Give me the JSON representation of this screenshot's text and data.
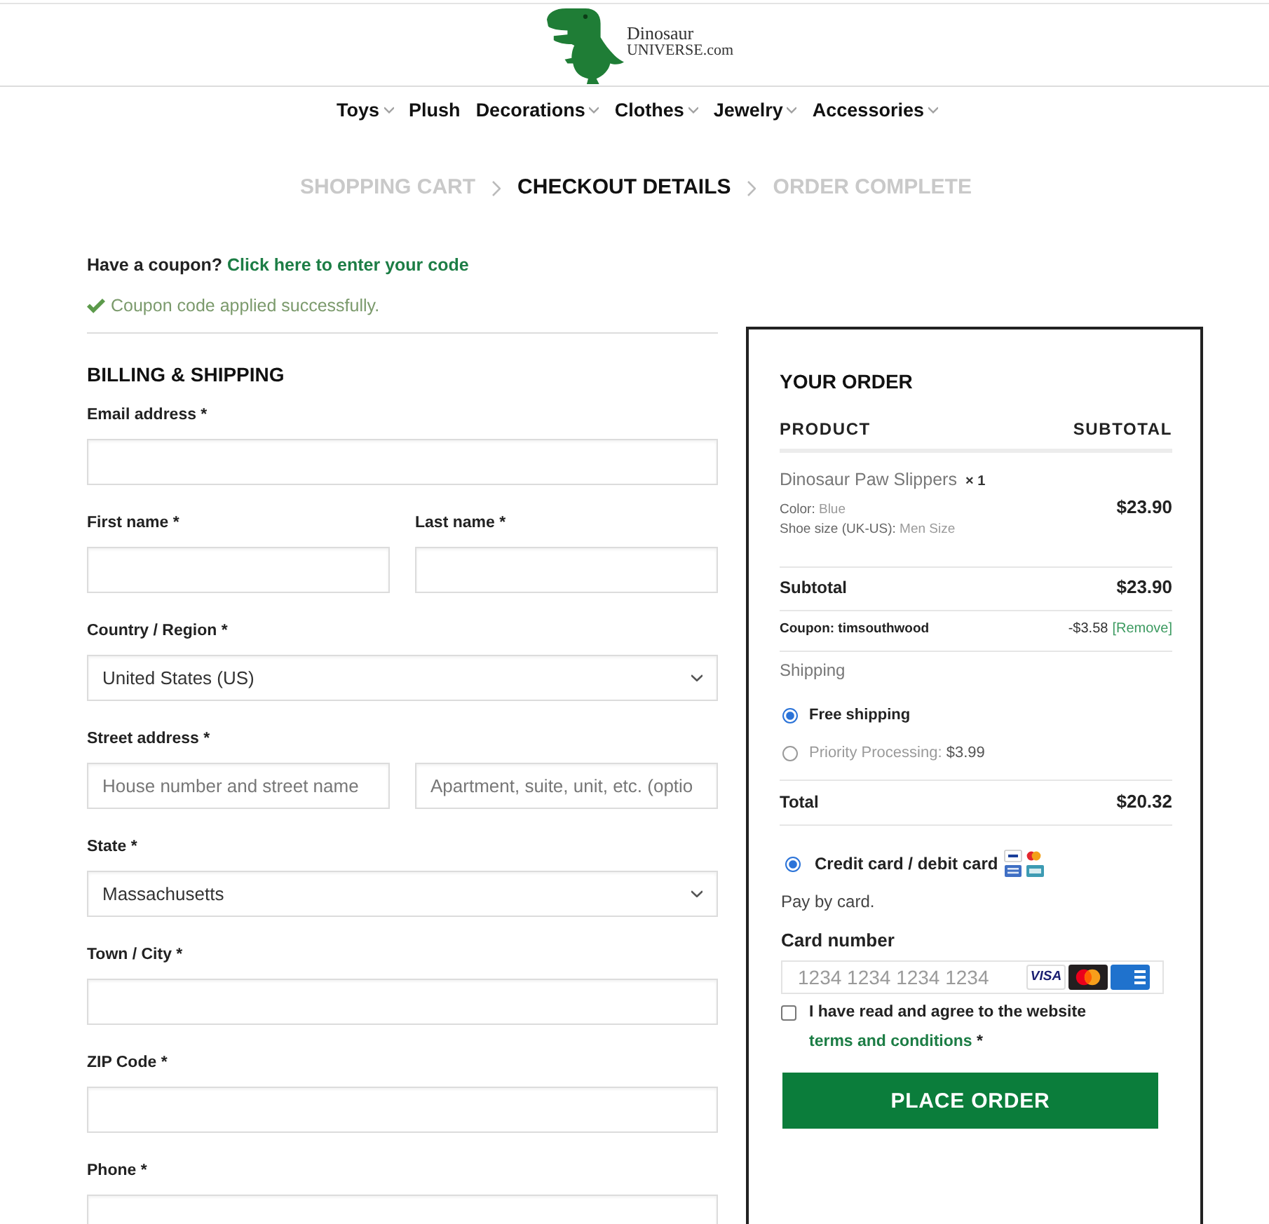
{
  "header": {
    "logo": {
      "name": "Dinosaur",
      "domain": "UNIVERSE.com"
    },
    "nav": [
      {
        "label": "Toys",
        "dropdown": true
      },
      {
        "label": "Plush",
        "dropdown": false
      },
      {
        "label": "Decorations",
        "dropdown": true
      },
      {
        "label": "Clothes",
        "dropdown": true
      },
      {
        "label": "Jewelry",
        "dropdown": true
      },
      {
        "label": "Accessories",
        "dropdown": true
      }
    ]
  },
  "steps": [
    {
      "label": "SHOPPING CART",
      "selected": false
    },
    {
      "label": "CHECKOUT DETAILS",
      "selected": true
    },
    {
      "label": "ORDER COMPLETE",
      "selected": false
    }
  ],
  "coupon": {
    "prompt": "Have a coupon?",
    "link": "Click here to enter your code",
    "notice": "Coupon code applied successfully."
  },
  "billing": {
    "title": "BILLING & SHIPPING",
    "rows": [
      {
        "fields": [
          {
            "label": "Email address *",
            "inputs": [
              {
                "kind": "text"
              }
            ]
          }
        ]
      },
      {
        "fields": [
          {
            "label": "First name *",
            "inputs": [
              {
                "kind": "text"
              }
            ]
          },
          {
            "label": "Last name *",
            "inputs": [
              {
                "kind": "text"
              }
            ]
          }
        ]
      },
      {
        "fields": [
          {
            "label": "Country / Region *",
            "inputs": [
              {
                "kind": "select",
                "value": "United States (US)"
              }
            ]
          }
        ]
      },
      {
        "fields": [
          {
            "label": "Street address *",
            "inputs": [
              {
                "kind": "text",
                "placeholder": "House number and street name"
              },
              {
                "kind": "text",
                "placeholder": "Apartment, suite, unit, etc. (optio"
              }
            ]
          }
        ]
      },
      {
        "fields": [
          {
            "label": "State *",
            "inputs": [
              {
                "kind": "select",
                "value": "Massachusetts"
              }
            ]
          }
        ]
      },
      {
        "fields": [
          {
            "label": "Town / City *",
            "inputs": [
              {
                "kind": "text"
              }
            ]
          }
        ]
      },
      {
        "fields": [
          {
            "label": "ZIP Code *",
            "inputs": [
              {
                "kind": "text"
              }
            ]
          }
        ]
      },
      {
        "fields": [
          {
            "label": "Phone *",
            "inputs": [
              {
                "kind": "text"
              }
            ]
          }
        ]
      }
    ]
  },
  "order": {
    "title": "YOUR ORDER",
    "columns": [
      "PRODUCT",
      "SUBTOTAL"
    ],
    "items": [
      {
        "name": "Dinosaur Paw Slippers",
        "quantity": "× 1",
        "meta": [
          {
            "label": "Color:",
            "value": "Blue"
          },
          {
            "label": "Shoe size (UK-US):",
            "value": "Men Size"
          }
        ],
        "subtotal": "$23.90"
      }
    ],
    "subtotal": {
      "label": "Subtotal",
      "value": "$23.90"
    },
    "coupon": {
      "label": "Coupon: timsouthwood",
      "amount": "-$3.58",
      "remove": "[Remove]"
    },
    "shipping": {
      "label": "Shipping",
      "options": [
        {
          "label": "Free shipping",
          "selected": true
        },
        {
          "label": "Priority Processing:",
          "price": "$3.99",
          "selected": false
        }
      ]
    },
    "total": {
      "label": "Total",
      "value": "$20.32"
    },
    "payment": {
      "methods": [
        {
          "label": "Credit card / debit card",
          "selected": true,
          "description": "Pay by card."
        }
      ],
      "card": {
        "label": "Card number",
        "placeholder": "1234 1234 1234 1234",
        "brands": [
          {
            "kind": "wordmark",
            "text": "VISA"
          },
          {
            "kind": "circles"
          },
          {
            "kind": "tile"
          }
        ]
      }
    },
    "terms": {
      "checked": false,
      "text": "I have read and agree to the website",
      "link": "terms and conditions",
      "suffix": "*"
    },
    "button": "PLACE ORDER"
  }
}
